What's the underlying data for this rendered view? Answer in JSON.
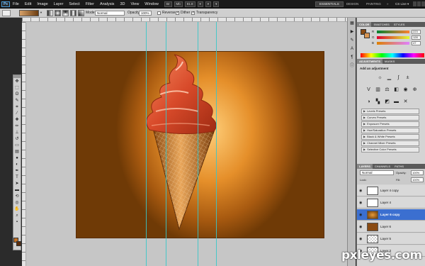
{
  "app": {
    "logo": "Ps"
  },
  "menu": [
    "File",
    "Edit",
    "Image",
    "Layer",
    "Select",
    "Filter",
    "Analysis",
    "3D",
    "View",
    "Window",
    "Help"
  ],
  "appbar_tools": [
    "Br",
    "Mb",
    "81.8",
    "▾",
    "▾",
    "▾"
  ],
  "workspaces": {
    "essentials": "ESSENTIALS",
    "design": "DESIGN",
    "painting": "PAINTING",
    "more": "»",
    "cslive": "CS Live ▾"
  },
  "options": {
    "mode_label": "Mode:",
    "mode_value": "Normal",
    "opacity_label": "Opacity:",
    "opacity_value": "100%",
    "reverse_label": "Reverse",
    "dither_label": "Dither",
    "transparency_label": "Transparency",
    "reverse_checked": false,
    "dither_checked": true,
    "transparency_checked": true
  },
  "colors": {
    "foreground": "#c27125",
    "background": "#5b2e0c",
    "guide": "#38c6c9",
    "selection": "#3b6fd0"
  },
  "color_panel": {
    "tabs": [
      "COLOR",
      "SWATCHES",
      "STYLES"
    ],
    "sliders": [
      {
        "label": "R",
        "value": "223"
      },
      {
        "label": "G",
        "value": "128"
      },
      {
        "label": "B",
        "value": "47"
      }
    ]
  },
  "adjustments": {
    "tabs": [
      "ADJUSTMENTS",
      "MASKS"
    ],
    "title": "Add an adjustment",
    "presets": [
      "Levels Presets",
      "Curves Presets",
      "Exposure Presets",
      "Hue/Saturation Presets",
      "Black & White Presets",
      "Channel Mixer Presets",
      "Selective Color Presets"
    ]
  },
  "layers": {
    "tabs": [
      "LAYERS",
      "CHANNELS",
      "PATHS"
    ],
    "blend_mode": "Normal",
    "opacity_label": "Opacity:",
    "opacity_value": "100%",
    "lock_label": "Lock:",
    "fill_label": "Fill:",
    "fill_value": "100%",
    "items": [
      {
        "name": "Layer 4 copy",
        "thumb": "cone",
        "active": false
      },
      {
        "name": "Layer 4",
        "thumb": "cone",
        "active": false
      },
      {
        "name": "Layer 6 copy",
        "thumb": "radial",
        "active": true
      },
      {
        "name": "Layer 6",
        "thumb": "brown",
        "active": false
      },
      {
        "name": "Layer 5",
        "thumb": "transparent",
        "active": false
      },
      {
        "name": "Layer 3",
        "thumb": "transparent",
        "active": false
      }
    ]
  },
  "watermark": "pxleyes.com"
}
